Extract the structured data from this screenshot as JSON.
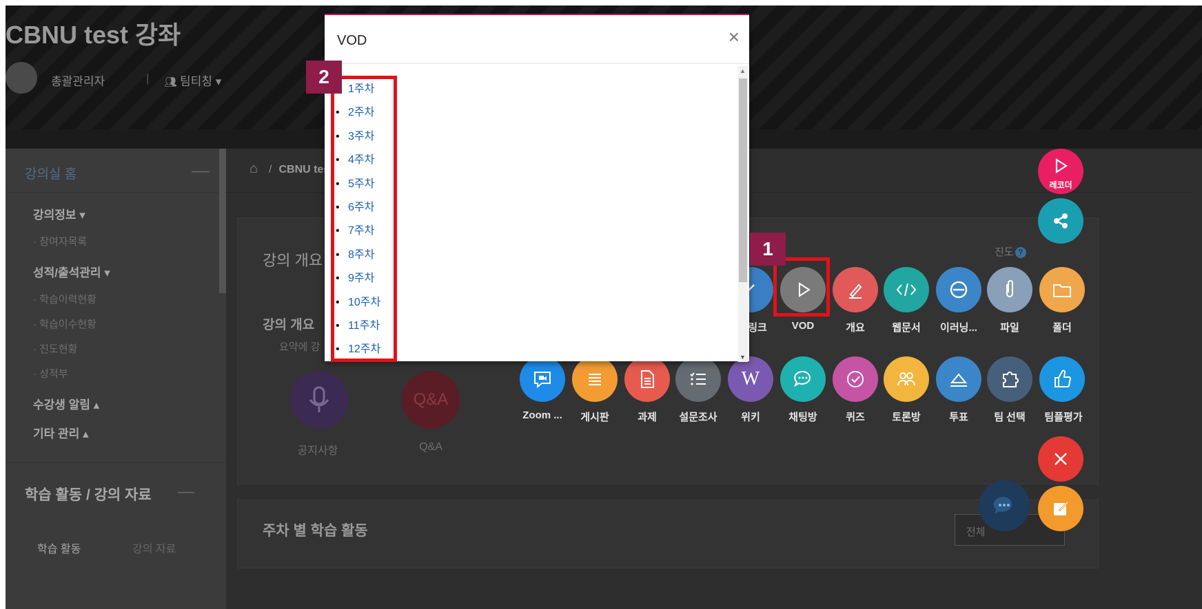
{
  "header": {
    "course_title": "CBNU test 강좌",
    "user_name": "총괄관리자",
    "separator": "|",
    "team_teaching": "팀티칭 ▾"
  },
  "sidebar": {
    "home": "강의실 홈",
    "collapse_symbol": "—",
    "groups": [
      {
        "label": "강의정보 ▾",
        "items": [
          "· 참여자목록"
        ]
      },
      {
        "label": "성적/출석관리 ▾",
        "items": [
          "· 학습이력현황",
          "· 학습이수현황",
          "· 진도현황",
          "· 성적부"
        ]
      },
      {
        "label": "수강생 알림 ▴",
        "items": []
      },
      {
        "label": "기타 관리 ▴",
        "items": []
      }
    ],
    "learning_section": "학습 활동 / 강의 자료",
    "tabs": [
      "학습 활동",
      "강의 자료"
    ]
  },
  "main": {
    "breadcrumb_home": "⌂",
    "breadcrumb_sep": "/",
    "breadcrumb_course": "CBNU test",
    "overview_heading": "강의 개요",
    "overview_sub": "강의 개요",
    "summary_text": "요약에 강",
    "progress_label": "진도",
    "notice_label": "공지사항",
    "qa_circle_text": "Q&A",
    "qa_label": "Q&A",
    "weekly_heading": "주차 별 학습 활동",
    "weekly_select": "전체"
  },
  "activities_row1": [
    {
      "name": "link",
      "label": "링크",
      "color": "#3a7fc4"
    },
    {
      "name": "vod",
      "label": "VOD",
      "color": "#7a7a7a"
    },
    {
      "name": "summary",
      "label": "개요",
      "color": "#e05a5a"
    },
    {
      "name": "webdoc",
      "label": "웹문서",
      "color": "#21a6a1"
    },
    {
      "name": "elearning",
      "label": "이러닝...",
      "color": "#3a86c8"
    },
    {
      "name": "file",
      "label": "파일",
      "color": "#8aa0b8"
    },
    {
      "name": "folder",
      "label": "폴더",
      "color": "#f0a64a"
    }
  ],
  "activities_row2": [
    {
      "name": "zoom",
      "label": "Zoom ...",
      "color": "#1e8be8"
    },
    {
      "name": "board",
      "label": "게시판",
      "color": "#f39c34"
    },
    {
      "name": "assignment",
      "label": "과제",
      "color": "#e65b4e"
    },
    {
      "name": "survey",
      "label": "설문조사",
      "color": "#646b72"
    },
    {
      "name": "wiki",
      "label": "위키",
      "color": "#7a5ab0"
    },
    {
      "name": "chat",
      "label": "채팅방",
      "color": "#1fb1b0"
    },
    {
      "name": "quiz",
      "label": "퀴즈",
      "color": "#c654a4"
    },
    {
      "name": "discussion",
      "label": "토론방",
      "color": "#f2b53d"
    },
    {
      "name": "vote",
      "label": "투표",
      "color": "#3a86c8"
    },
    {
      "name": "team-select",
      "label": "팀 선택",
      "color": "#46607c"
    },
    {
      "name": "team-eval",
      "label": "팀플평가",
      "color": "#1c96e0"
    }
  ],
  "floating": {
    "recorder_label": "레코더",
    "recorder_color": "#e91e63",
    "share_color": "#1a9fb0",
    "close_color": "#e53935",
    "edit_color": "#f29a2b"
  },
  "modal": {
    "title": "VOD",
    "close": "×",
    "weeks": [
      "1주차",
      "2주차",
      "3주차",
      "4주차",
      "5주차",
      "6주차",
      "7주차",
      "8주차",
      "9주차",
      "10주차",
      "11주차",
      "12주차"
    ]
  },
  "annotations": {
    "badge_1": "1",
    "badge_2": "2",
    "color": "#e1121a",
    "badge_color": "#8e1d4a"
  }
}
